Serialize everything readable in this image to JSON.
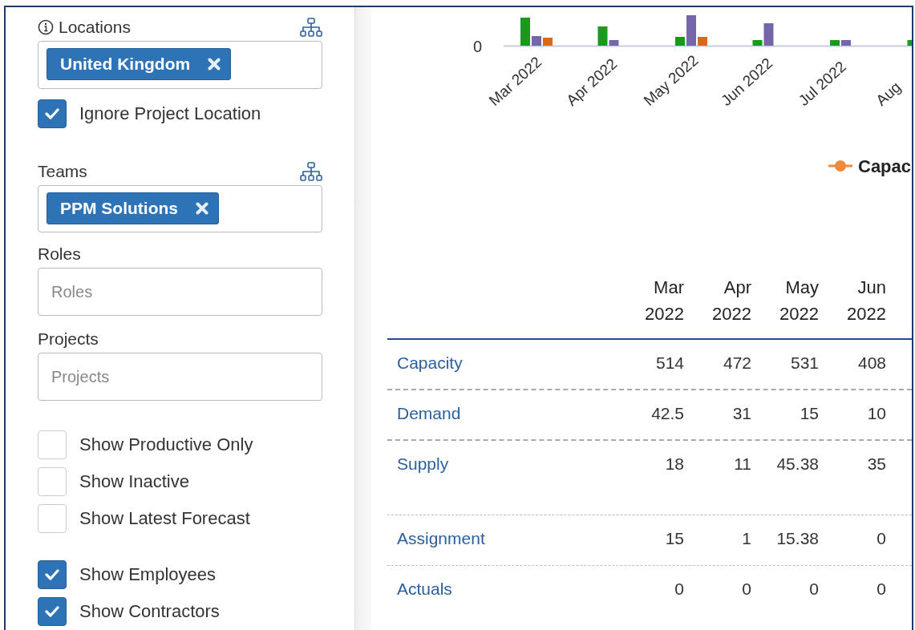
{
  "sidebar": {
    "fields": [
      {
        "kind": "tags",
        "label": "Locations",
        "info": true,
        "hierarchy": true,
        "tags": [
          "United Kingdom"
        ]
      },
      {
        "kind": "checkbox",
        "label": "Ignore Project Location",
        "checked": true
      },
      {
        "kind": "tags",
        "label": "Teams",
        "hierarchy": true,
        "tags": [
          "PPM Solutions"
        ]
      },
      {
        "kind": "input",
        "label": "Roles",
        "placeholder": "Roles"
      },
      {
        "kind": "input",
        "label": "Projects",
        "placeholder": "Projects"
      }
    ],
    "option_groups": [
      {
        "options": [
          {
            "label": "Show Productive Only",
            "checked": false
          },
          {
            "label": "Show Inactive",
            "checked": false
          },
          {
            "label": "Show Latest Forecast",
            "checked": false
          }
        ]
      },
      {
        "options": [
          {
            "label": "Show Employees",
            "checked": true
          },
          {
            "label": "Show Contractors",
            "checked": true
          }
        ]
      }
    ]
  },
  "chart": {
    "zero_tick": "0",
    "months": [
      "Mar 2022",
      "Apr 2022",
      "May 2022",
      "Jun 2022",
      "Jul 2022",
      "Aug"
    ],
    "legend": "Capac"
  },
  "table": {
    "columns": [
      [
        "Mar",
        "2022"
      ],
      [
        "Apr",
        "2022"
      ],
      [
        "May",
        "2022"
      ],
      [
        "Jun",
        "2022"
      ]
    ],
    "rows": [
      {
        "kind": "total",
        "label": "Capacity",
        "values": [
          "514",
          "472",
          "531",
          "408"
        ]
      },
      {
        "kind": "total",
        "label": "Demand",
        "values": [
          "42.5",
          "31",
          "15",
          "10"
        ]
      },
      {
        "kind": "total",
        "label": "Supply",
        "values": [
          "18",
          "11",
          "45.38",
          "35"
        ]
      },
      {
        "kind": "part",
        "label": "Assignment",
        "values": [
          "15",
          "1",
          "15.38",
          "0"
        ]
      },
      {
        "kind": "part",
        "label": "Actuals",
        "values": [
          "0",
          "0",
          "0",
          "0"
        ]
      }
    ]
  }
}
